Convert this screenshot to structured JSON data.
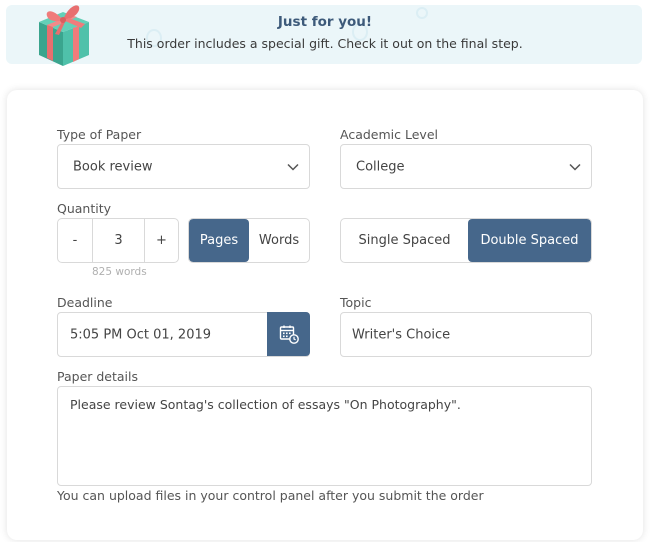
{
  "banner": {
    "icon": "gift-icon",
    "title": "Just for you!",
    "text": "This order includes a special gift. Check it out on the final step."
  },
  "form": {
    "type_of_paper": {
      "label": "Type of Paper",
      "value": "Book review"
    },
    "academic_level": {
      "label": "Academic Level",
      "value": "College"
    },
    "quantity": {
      "label": "Quantity",
      "minus_label": "-",
      "value": "3",
      "plus_label": "+",
      "hint": "825 words",
      "unit_options": [
        {
          "label": "Pages",
          "selected": true
        },
        {
          "label": "Words",
          "selected": false
        }
      ]
    },
    "spacing": {
      "options": [
        {
          "label": "Single Spaced",
          "selected": false
        },
        {
          "label": "Double Spaced",
          "selected": true
        }
      ]
    },
    "deadline": {
      "label": "Deadline",
      "value": "5:05 PM Oct 01, 2019",
      "icon": "calendar-clock-icon"
    },
    "topic": {
      "label": "Topic",
      "value": "Writer's Choice"
    },
    "paper_details": {
      "label": "Paper details",
      "value": "Please review Sontag's collection of essays \"On Photography\".",
      "note": "You can upload files in your control panel after you submit the order"
    }
  },
  "colors": {
    "accent": "#46678b",
    "banner_bg": "#ebf6f9",
    "banner_title": "#3d5a7a",
    "gift_box": "#4fc1aa",
    "gift_ribbon": "#f07b7b"
  }
}
